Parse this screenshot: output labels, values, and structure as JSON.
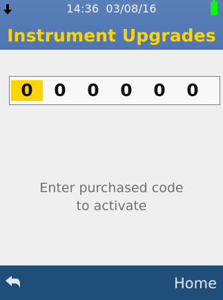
{
  "status": {
    "time": "14:36",
    "date": "03/08/16",
    "download_icon": "download-arrow-icon",
    "battery_icon": "battery-full-icon",
    "battery_color": "#00ff00"
  },
  "header": {
    "title": "Instrument Upgrades",
    "title_color": "#ffd400",
    "background_color": "#4f76b1"
  },
  "code": {
    "digits": [
      "0",
      "0",
      "0",
      "0",
      "0",
      "0"
    ],
    "active_index": 0,
    "active_color": "#ffd400"
  },
  "message": {
    "line1": "Enter purchased code",
    "line2": "to activate"
  },
  "footer": {
    "back_icon": "back-arrow-icon",
    "home_label": "Home",
    "background_color": "#1f4e7b"
  }
}
